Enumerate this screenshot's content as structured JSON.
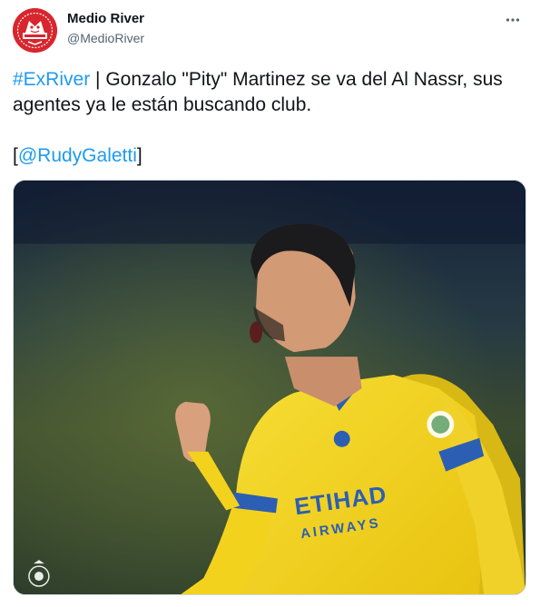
{
  "author": {
    "name": "Medio River",
    "handle": "@MedioRiver",
    "avatar_icon": "medio-river-logo",
    "avatar_color": "#d8262e"
  },
  "tweet": {
    "hashtag": "#ExRiver",
    "text_main": " | Gonzalo \"Pity\" Martinez se va del Al Nassr, sus agentes ya le están buscando club.",
    "mention_open": "[",
    "mention": "@RudyGaletti",
    "mention_close": "]"
  },
  "photo": {
    "subject": "player celebrating in yellow Al Nassr kit",
    "shirt_text_1": "ETIHAD",
    "shirt_text_2": "AIRWAYS",
    "jersey_color": "#f5d31c",
    "accent_color": "#2c5fb3"
  },
  "colors": {
    "link": "#1d9bf0",
    "secondary_text": "#536471"
  },
  "more_icon": "more-dots-icon"
}
